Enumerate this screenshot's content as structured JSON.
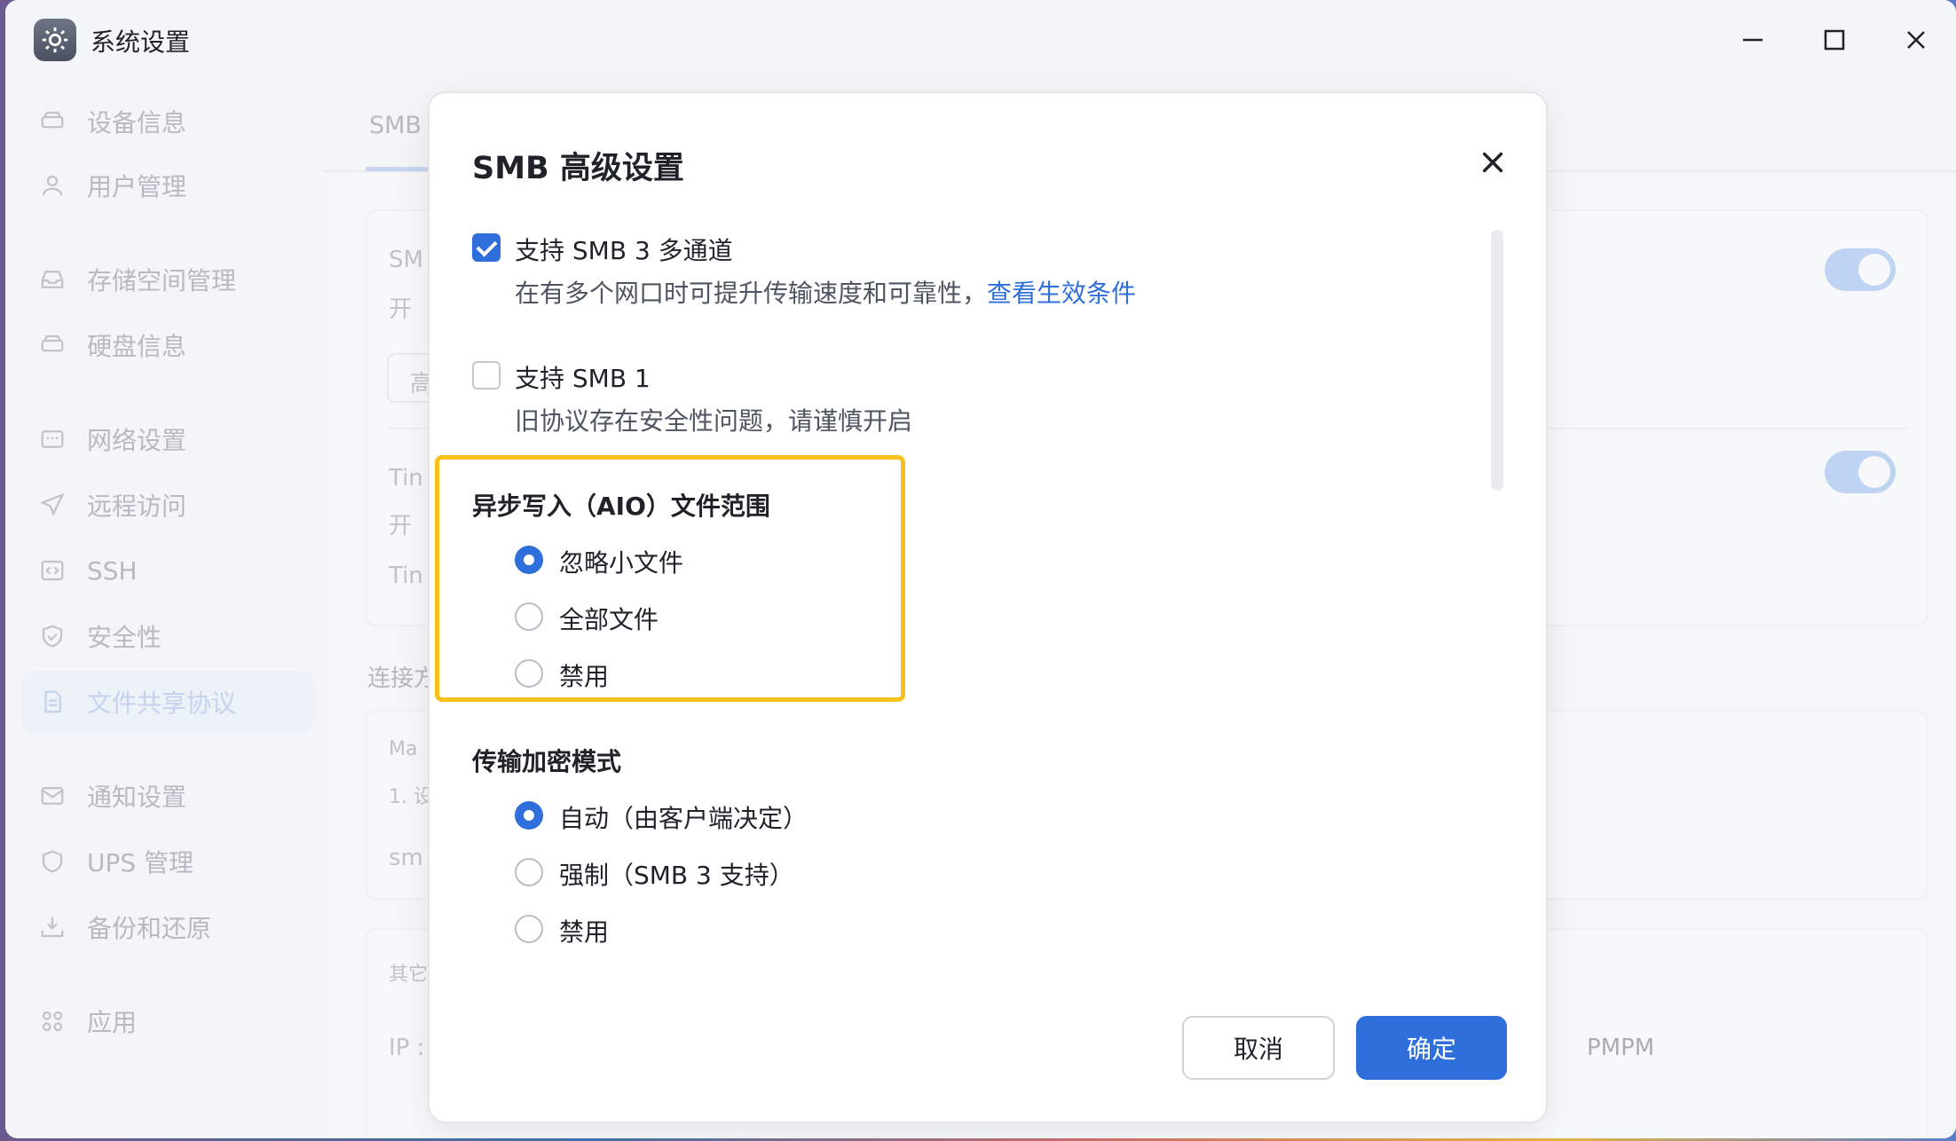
{
  "window": {
    "title": "系统设置"
  },
  "sidebar": {
    "items": [
      {
        "label": "设备信息",
        "icon": "hard-drive-icon"
      },
      {
        "label": "用户管理",
        "icon": "user-icon"
      },
      {
        "label": "存储空间管理",
        "icon": "inbox-icon"
      },
      {
        "label": "硬盘信息",
        "icon": "disk-icon"
      },
      {
        "label": "网络设置",
        "icon": "network-icon"
      },
      {
        "label": "远程访问",
        "icon": "send-icon"
      },
      {
        "label": "SSH",
        "icon": "code-icon"
      },
      {
        "label": "安全性",
        "icon": "shield-check-icon"
      },
      {
        "label": "文件共享协议",
        "icon": "document-icon",
        "active": true
      },
      {
        "label": "通知设置",
        "icon": "mail-icon"
      },
      {
        "label": "UPS 管理",
        "icon": "shield-icon"
      },
      {
        "label": "备份和还原",
        "icon": "download-tray-icon"
      },
      {
        "label": "应用",
        "icon": "grid-icon"
      }
    ]
  },
  "background": {
    "tab": "SMB",
    "card1_title": "SM",
    "card1_sub": "开",
    "card1_field": "高",
    "card2_title": "Tin",
    "card2_sub": "开",
    "card2_row": "Tin",
    "section_connect": "连接方",
    "card3_line1": "Ma",
    "card3_line2": "1. 设",
    "card3_line3": "sm",
    "card4_title": "其它",
    "card4_ip": "IP :",
    "card4_right": "PMPM"
  },
  "dialog": {
    "title": "SMB 高级设置",
    "multichannel": {
      "label": "支持 SMB 3 多通道",
      "checked": true,
      "desc": "在有多个网口时可提升传输速度和可靠性，",
      "link": "查看生效条件"
    },
    "smb1": {
      "label": "支持 SMB 1",
      "checked": false,
      "desc": "旧协议存在安全性问题，请谨慎开启"
    },
    "aio": {
      "title": "异步写入（AIO）文件范围",
      "options": [
        "忽略小文件",
        "全部文件",
        "禁用"
      ],
      "selected": 0
    },
    "encryption": {
      "title": "传输加密模式",
      "options": [
        "自动（由客户端决定）",
        "强制（SMB 3 支持）",
        "禁用"
      ],
      "selected": 0
    },
    "cancel_label": "取消",
    "ok_label": "确定"
  },
  "colors": {
    "accent": "#2f6fdb",
    "highlight": "#f6c21b"
  }
}
